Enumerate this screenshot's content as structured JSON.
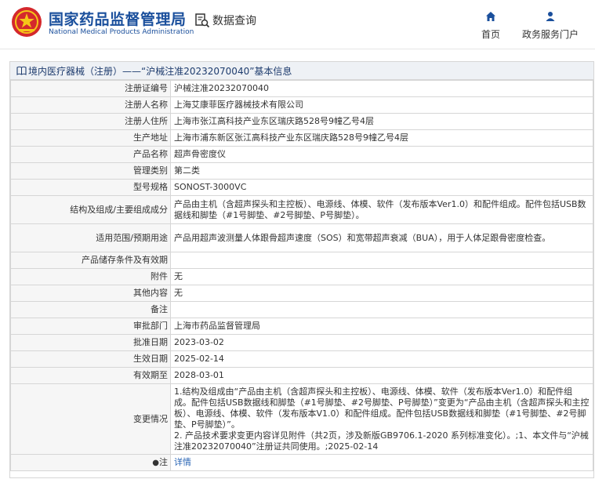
{
  "header": {
    "brand_cn": "国家药品监督管理局",
    "brand_en": "National Medical Products Administration",
    "data_query": "数据查询",
    "nav": [
      {
        "label": "首页",
        "icon": "home-icon"
      },
      {
        "label": "政务服务门户",
        "icon": "user-icon"
      }
    ]
  },
  "panel": {
    "crumb_link": "境内医疗器械（注册）",
    "crumb_rest": "——“沪械注准20232070040”基本信息"
  },
  "rows": [
    {
      "key": "注册证编号",
      "value": "沪械注准20232070040"
    },
    {
      "key": "注册人名称",
      "value": "上海艾康菲医疗器械技术有限公司"
    },
    {
      "key": "注册人住所",
      "value": "上海市张江高科技产业东区瑞庆路528号9幢乙号4层"
    },
    {
      "key": "生产地址",
      "value": "上海市浦东新区张江高科技产业东区瑞庆路528号9幢乙号4层"
    },
    {
      "key": "产品名称",
      "value": "超声骨密度仪"
    },
    {
      "key": "管理类别",
      "value": "第二类"
    },
    {
      "key": "型号规格",
      "value": "SONOST-3000VC"
    },
    {
      "key": "结构及组成/主要组成成分",
      "value": "产品由主机（含超声探头和主控板）、电源线、体模、软件（发布版本Ver1.0）和配件组成。配件包括USB数据线和脚垫（#1号脚垫、#2号脚垫、P号脚垫）。"
    },
    {
      "key": "适用范围/预期用途",
      "value": "产品用超声波测量人体跟骨超声速度（SOS）和宽带超声衰减（BUA），用于人体足跟骨密度检查。"
    },
    {
      "key": "产品储存条件及有效期",
      "value": ""
    },
    {
      "key": "附件",
      "value": "无"
    },
    {
      "key": "其他内容",
      "value": "无"
    },
    {
      "key": "备注",
      "value": ""
    },
    {
      "key": "审批部门",
      "value": "上海市药品监督管理局"
    },
    {
      "key": "批准日期",
      "value": "2023-03-02"
    },
    {
      "key": "生效日期",
      "value": "2025-02-14"
    },
    {
      "key": "有效期至",
      "value": "2028-03-01"
    },
    {
      "key": "变更情况",
      "value": "1.结构及组成由“产品由主机（含超声探头和主控板）、电源线、体模、软件（发布版本Ver1.0）和配件组成。配件包括USB数据线和脚垫（#1号脚垫、#2号脚垫、P号脚垫）”变更为“产品由主机（含超声探头和主控板）、电源线、体模、软件（发布版本V1.0）和配件组成。配件包括USB数据线和脚垫（#1号脚垫、#2号脚垫、P号脚垫）”。\n2. 产品技术要求变更内容详见附件（共2页，涉及新版GB9706.1-2020 系列标准变化）。;1、本文件与“沪械注准20232070040”注册证共同使用。;2025-02-14"
    }
  ],
  "note": {
    "key": "注",
    "link": "详情"
  },
  "colors": {
    "brand": "#1a4f9c",
    "link": "#2a65b5",
    "label_bg": "#f6f6f6",
    "title_bg": "#eef1f5"
  }
}
